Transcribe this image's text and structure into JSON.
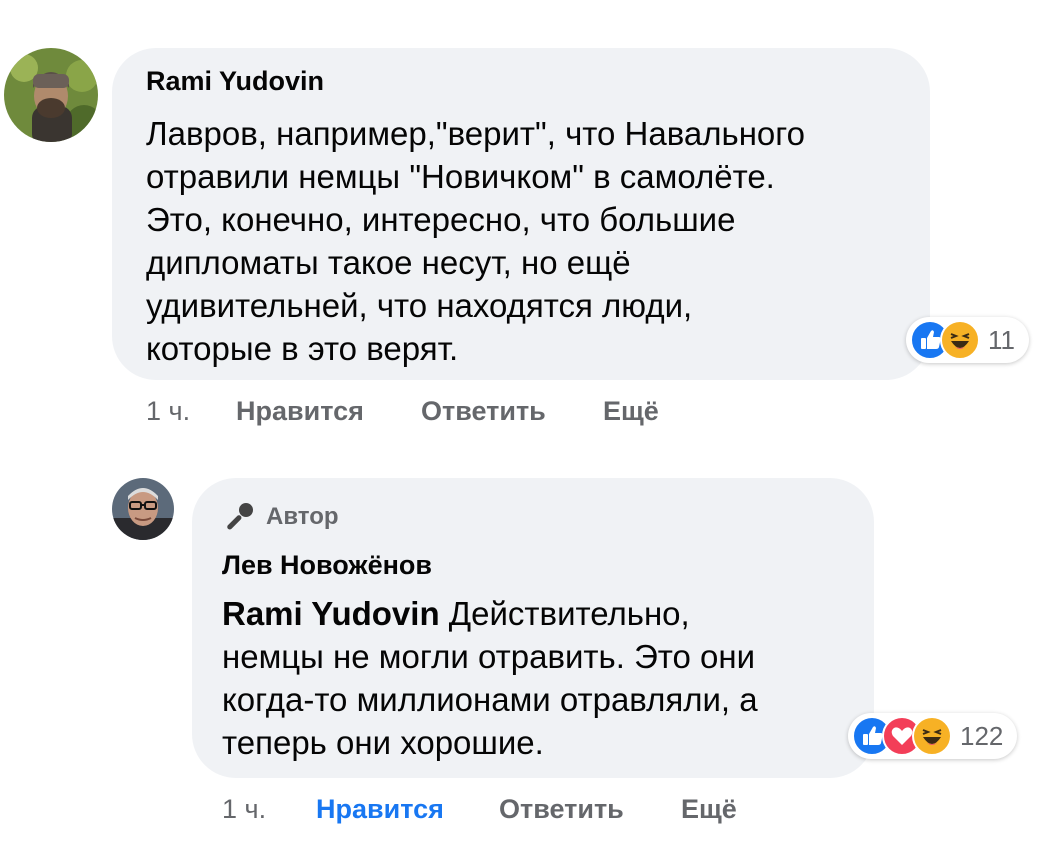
{
  "comments": [
    {
      "author": "Rami Yudovin",
      "text_lines": [
        "Лавров, например,\"верит\", что Навального",
        "отравили немцы \"Новичком\" в самолёте.",
        "Это, конечно, интересно, что большие",
        "дипломаты такое несут, но ещё",
        "удивительней, что находятся люди,",
        "которые в это верят."
      ],
      "reactions": {
        "icons": [
          "like-icon",
          "haha-icon"
        ],
        "count": "11"
      },
      "time": "1 ч.",
      "like_label": "Нравится",
      "reply_label": "Ответить",
      "more_label": "Ещё"
    },
    {
      "badge": "Автор",
      "author": "Лев Новожёнов",
      "mention": "Rami Yudovin",
      "text_first": " Действительно,",
      "text_lines": [
        "немцы не могли отравить. Это они",
        "когда-то миллионами отравляли, а",
        "теперь они хорошие."
      ],
      "reactions": {
        "icons": [
          "like-icon",
          "love-icon",
          "haha-icon"
        ],
        "count": "122"
      },
      "time": "1 ч.",
      "like_label": "Нравится",
      "reply_label": "Ответить",
      "more_label": "Ещё",
      "liked": true
    }
  ],
  "colors": {
    "bubble": "#f0f2f5",
    "link_blue": "#1877f2",
    "meta_gray": "#65676b",
    "like": "#1877f2",
    "love": "#f33e58",
    "haha": "#f7b125"
  }
}
